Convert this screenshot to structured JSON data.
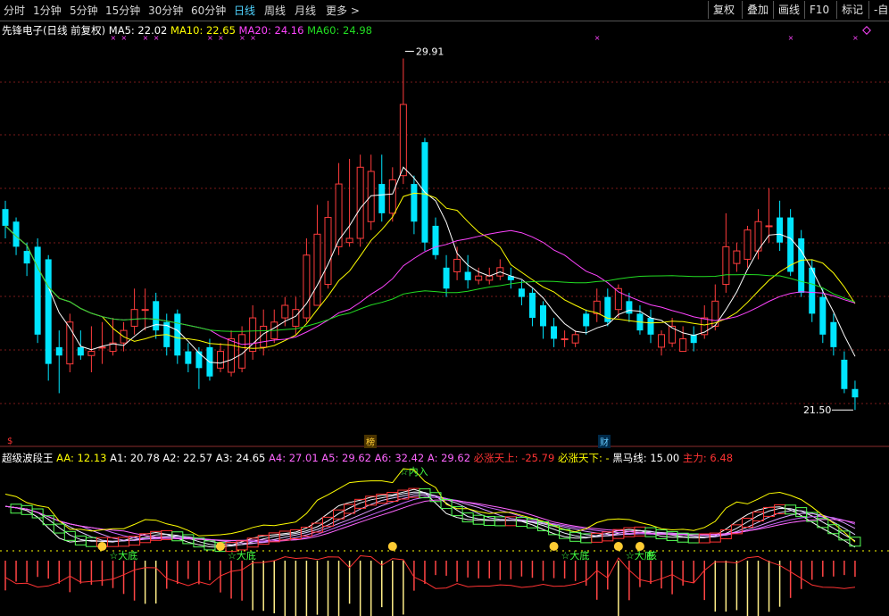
{
  "toolbar": {
    "timeframes": [
      "分时",
      "1分钟",
      "5分钟",
      "15分钟",
      "30分钟",
      "60分钟",
      "日线",
      "周线",
      "月线",
      "更多 >"
    ],
    "active": "日线",
    "right_buttons": [
      "复权",
      "叠加",
      "画线",
      "F10",
      "标记",
      "-自选"
    ]
  },
  "price_panel": {
    "stock_title": "先锋电子(日线 前复权)",
    "ma": [
      {
        "label": "MA5: 22.02",
        "color": "#ffffff"
      },
      {
        "label": "MA10: 22.65",
        "color": "#ffff00"
      },
      {
        "label": "MA20: 24.16",
        "color": "#ff44ff"
      },
      {
        "label": "MA60: 24.98",
        "color": "#22dd22"
      }
    ],
    "high_label": "29.91",
    "low_label": "21.50",
    "markers": {
      "left": "$",
      "bang": "榜",
      "cai": "财"
    }
  },
  "indicator_panel": {
    "title": "超级波段王",
    "values": [
      {
        "label": "AA: 12.13",
        "color": "#ffff00"
      },
      {
        "label": "A1: 20.78",
        "color": "#ffffff"
      },
      {
        "label": "A2: 22.57",
        "color": "#ffffff"
      },
      {
        "label": "A3: 24.65",
        "color": "#ffffff"
      },
      {
        "label": "A4: 27.01",
        "color": "#ff66ff"
      },
      {
        "label": "A5: 29.62",
        "color": "#ff66ff"
      },
      {
        "label": "A6: 32.42",
        "color": "#ff66ff"
      },
      {
        "label": "A: 29.62",
        "color": "#ff66ff"
      },
      {
        "label": "必涨天上: -25.79",
        "color": "#ff3333"
      },
      {
        "label": "必涨天下: -",
        "color": "#ffff00"
      },
      {
        "label": "黑马线: 15.00",
        "color": "#ffffff"
      },
      {
        "label": "主力: 6.48",
        "color": "#ff3333"
      }
    ],
    "annotations": [
      {
        "text": "☆大底",
        "i": 9
      },
      {
        "text": "☆大底",
        "i": 20
      },
      {
        "text": "☆内入",
        "i": 36
      },
      {
        "text": "☆大底",
        "i": 51
      },
      {
        "text": "☆大底",
        "i": 57
      },
      {
        "text": "核",
        "i": 59
      }
    ]
  },
  "chart_data": {
    "type": "candlestick",
    "ylim": [
      20.8,
      30.4
    ],
    "x": [
      "1",
      "2",
      "3",
      "4",
      "5",
      "6",
      "7",
      "8",
      "9",
      "10",
      "11",
      "12",
      "13",
      "14",
      "15",
      "16",
      "17",
      "18",
      "19",
      "20",
      "21",
      "22",
      "23",
      "24",
      "25",
      "26",
      "27",
      "28",
      "29",
      "30",
      "31",
      "32",
      "33",
      "34",
      "35",
      "36",
      "37",
      "38",
      "39",
      "40",
      "41",
      "42",
      "43",
      "44",
      "45",
      "46",
      "47",
      "48",
      "49",
      "50",
      "51",
      "52",
      "53",
      "54",
      "55",
      "56",
      "57",
      "58",
      "59",
      "60",
      "61",
      "62",
      "63",
      "64",
      "65",
      "66",
      "67",
      "68",
      "69",
      "70",
      "71",
      "72",
      "73",
      "74",
      "75",
      "76",
      "77",
      "78",
      "79",
      "80"
    ],
    "open": [
      26.3,
      26.0,
      25.3,
      25.4,
      25.1,
      23.0,
      22.6,
      23.0,
      22.8,
      23.0,
      22.9,
      23.1,
      23.5,
      23.9,
      24.1,
      23.6,
      23.8,
      22.9,
      22.9,
      23.0,
      22.5,
      22.4,
      22.5,
      22.9,
      23.0,
      23.2,
      23.7,
      23.5,
      23.7,
      24.0,
      24.5,
      25.4,
      25.5,
      25.6,
      26.0,
      26.9,
      26.2,
      27.1,
      26.9,
      27.9,
      25.9,
      24.9,
      24.8,
      24.8,
      24.6,
      24.6,
      24.7,
      24.7,
      24.4,
      24.3,
      24.0,
      23.5,
      23.2,
      23.1,
      23.8,
      23.8,
      24.2,
      23.9,
      24.1,
      23.8,
      23.7,
      23.0,
      23.1,
      22.9,
      23.3,
      23.3,
      23.5,
      24.5,
      25.0,
      25.1,
      25.3,
      25.9,
      26.1,
      26.1,
      25.6,
      24.9,
      24.2,
      23.6,
      22.7,
      22.0
    ],
    "close": [
      25.9,
      25.4,
      25.0,
      23.3,
      22.6,
      22.8,
      23.6,
      22.8,
      22.9,
      23.0,
      23.1,
      23.4,
      23.9,
      23.9,
      23.4,
      23.0,
      22.8,
      22.6,
      22.5,
      22.3,
      22.9,
      23.2,
      23.3,
      23.7,
      23.5,
      23.6,
      24.0,
      23.9,
      25.2,
      25.7,
      26.1,
      26.9,
      25.6,
      27.3,
      27.2,
      26.2,
      27.0,
      28.8,
      26.0,
      25.5,
      25.2,
      24.4,
      25.1,
      24.6,
      24.7,
      24.7,
      24.9,
      24.6,
      24.2,
      23.7,
      23.5,
      23.2,
      23.2,
      23.3,
      23.5,
      24.1,
      23.6,
      24.4,
      23.8,
      23.4,
      23.3,
      23.3,
      23.5,
      23.2,
      23.1,
      23.7,
      24.1,
      25.4,
      25.3,
      25.8,
      26.0,
      25.9,
      25.5,
      24.8,
      24.3,
      23.8,
      23.3,
      23.0,
      22.0,
      21.8
    ],
    "high": [
      26.5,
      26.1,
      25.5,
      25.6,
      25.2,
      23.4,
      23.8,
      23.4,
      23.5,
      23.6,
      23.7,
      23.6,
      24.4,
      24.4,
      24.3,
      23.8,
      23.9,
      23.1,
      23.0,
      23.2,
      23.1,
      23.4,
      23.5,
      24.0,
      23.9,
      23.9,
      24.2,
      24.2,
      25.6,
      26.4,
      26.5,
      27.4,
      27.5,
      27.6,
      27.6,
      27.6,
      27.3,
      29.9,
      27.1,
      28.0,
      26.1,
      25.2,
      25.4,
      25.2,
      24.9,
      24.9,
      25.1,
      24.9,
      24.6,
      24.4,
      24.1,
      23.7,
      23.4,
      23.4,
      23.9,
      24.4,
      24.4,
      24.5,
      24.3,
      24.0,
      23.9,
      23.4,
      23.7,
      23.5,
      23.5,
      24.0,
      24.5,
      26.2,
      25.5,
      25.9,
      26.3,
      26.8,
      26.5,
      26.3,
      25.8,
      25.1,
      24.4,
      23.8,
      22.9,
      22.2
    ],
    "low": [
      25.6,
      25.2,
      24.7,
      23.1,
      22.2,
      21.9,
      22.4,
      22.7,
      22.4,
      22.6,
      22.8,
      22.9,
      23.3,
      23.4,
      23.2,
      22.8,
      22.6,
      22.4,
      22.0,
      22.2,
      22.4,
      22.3,
      22.4,
      22.7,
      22.8,
      23.1,
      23.5,
      23.3,
      23.6,
      24.0,
      24.4,
      25.2,
      25.4,
      25.4,
      25.8,
      26.0,
      26.0,
      26.9,
      25.7,
      25.3,
      25.1,
      24.2,
      24.6,
      24.4,
      24.5,
      24.5,
      24.6,
      24.4,
      24.0,
      23.5,
      23.2,
      23.0,
      23.0,
      23.0,
      23.3,
      23.6,
      23.5,
      23.7,
      23.6,
      23.3,
      23.1,
      22.8,
      23.0,
      22.9,
      22.9,
      23.2,
      23.4,
      24.3,
      24.8,
      24.9,
      25.1,
      25.5,
      25.3,
      24.7,
      24.2,
      23.6,
      23.1,
      22.8,
      21.9,
      21.5
    ]
  }
}
